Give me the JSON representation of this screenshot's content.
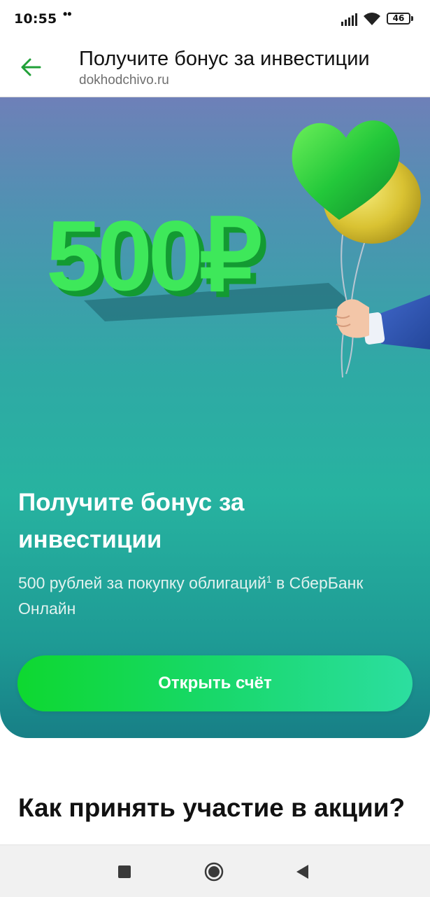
{
  "status_bar": {
    "time": "10:55",
    "dots": "••",
    "battery_level": "46",
    "icons": [
      "signal-icon",
      "wifi-icon",
      "battery-icon"
    ]
  },
  "header": {
    "back_icon": "arrow-left-icon",
    "title": "Получите бонус за инвестиции",
    "subtitle": "dokhodchivo.ru"
  },
  "banner": {
    "hero_amount": "500₽",
    "title": "Получите бонус за инвестиции",
    "subtitle": "500 рублей за покупку облигаций",
    "subtitle_footnote": "1",
    "subtitle_line2": " в СберБанк Онлайн",
    "button_label": "Открыть счёт"
  },
  "section": {
    "heading": "Как принять участие в акции?"
  },
  "nav_bar": {
    "icons": [
      "recent-apps-icon",
      "home-icon",
      "back-triangle-icon"
    ]
  },
  "colors": {
    "accent_green": "#21a038",
    "button_green": "#0ed830",
    "banner_top": "#6e80b8",
    "banner_bottom": "#177f86"
  }
}
